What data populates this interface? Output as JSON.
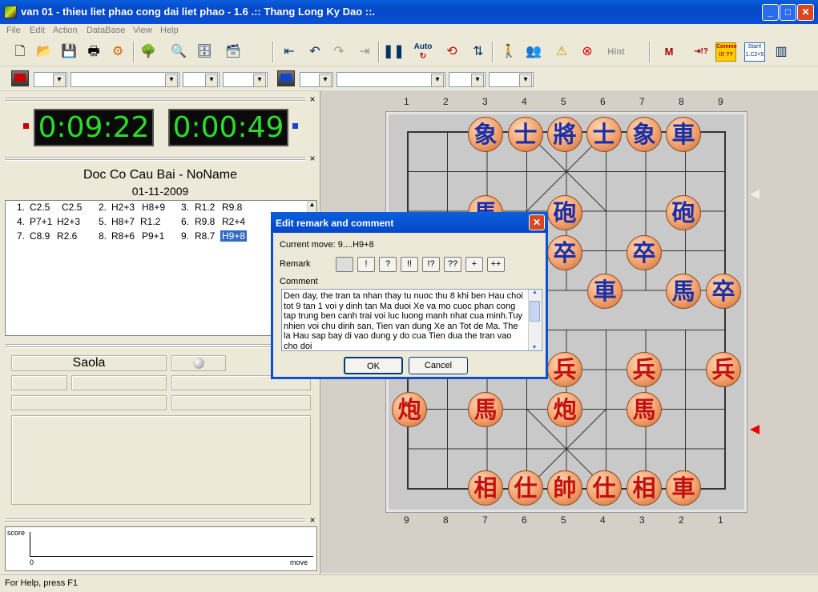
{
  "window": {
    "title": "van 01 - thieu liet phao cong dai liet phao - 1.6 .:: Thang Long Ky Dao ::."
  },
  "menu": [
    "File",
    "Edit",
    "Action",
    "DataBase",
    "View",
    "Help"
  ],
  "toolbar": {
    "auto_label": "Auto",
    "hint_label": "Hint",
    "comme_label": "Comme !!! ??",
    "start_label": "Start! 1.C2=5"
  },
  "clocks": {
    "red": "0:09:22",
    "black": "0:00:49"
  },
  "game": {
    "title": "Doc Co Cau Bai - NoName",
    "date": "01-11-2009"
  },
  "moves": [
    {
      "num": "1.",
      "red": "C2.5",
      "black": "C2.5"
    },
    {
      "num": "2.",
      "red": "H2+3",
      "black": "H8+9"
    },
    {
      "num": "3.",
      "red": "R1.2",
      "black": "R9.8"
    },
    {
      "num": "4.",
      "red": "P7+1",
      "black": "H2+3"
    },
    {
      "num": "5.",
      "red": "H8+7",
      "black": "R1.2"
    },
    {
      "num": "6.",
      "red": "R9.8",
      "black": "R2+4"
    },
    {
      "num": "7.",
      "red": "C8.9",
      "black": "R2.6"
    },
    {
      "num": "8.",
      "red": "R8+6",
      "black": "P9+1"
    },
    {
      "num": "9.",
      "red": "R8.7",
      "black": "H9+8"
    }
  ],
  "engine": {
    "name": "Saola"
  },
  "graph": {
    "ylabel": "score",
    "xlabel": "move",
    "origin": "0"
  },
  "board": {
    "files_top": [
      "1",
      "2",
      "3",
      "4",
      "5",
      "6",
      "7",
      "8",
      "9"
    ],
    "files_bottom": [
      "9",
      "8",
      "7",
      "6",
      "5",
      "4",
      "3",
      "2",
      "1"
    ],
    "pieces": [
      {
        "ch": "象",
        "side": "black"
      },
      {
        "ch": "士",
        "side": "black"
      },
      {
        "ch": "將",
        "side": "black"
      },
      {
        "ch": "士",
        "side": "black"
      },
      {
        "ch": "象",
        "side": "black"
      },
      {
        "ch": "車",
        "side": "black"
      },
      {
        "ch": "馬",
        "side": "black"
      },
      {
        "ch": "砲",
        "side": "black"
      },
      {
        "ch": "砲",
        "side": "black"
      },
      {
        "ch": "卒",
        "side": "black"
      },
      {
        "ch": "卒",
        "side": "black"
      },
      {
        "ch": "車",
        "side": "black"
      },
      {
        "ch": "馬",
        "side": "black"
      },
      {
        "ch": "卒",
        "side": "black"
      },
      {
        "ch": "兵",
        "side": "red"
      },
      {
        "ch": "兵",
        "side": "red"
      },
      {
        "ch": "兵",
        "side": "red"
      },
      {
        "ch": "炮",
        "side": "red"
      },
      {
        "ch": "馬",
        "side": "red"
      },
      {
        "ch": "炮",
        "side": "red"
      },
      {
        "ch": "馬",
        "side": "red"
      },
      {
        "ch": "相",
        "side": "red"
      },
      {
        "ch": "仕",
        "side": "red"
      },
      {
        "ch": "帥",
        "side": "red"
      },
      {
        "ch": "仕",
        "side": "red"
      },
      {
        "ch": "相",
        "side": "red"
      },
      {
        "ch": "車",
        "side": "red"
      }
    ]
  },
  "dialog": {
    "title": "Edit remark and comment",
    "current_move": "Current move: 9....H9+8",
    "remark_label": "Remark",
    "remark_options": [
      "",
      "!",
      "?",
      "!!",
      "!?",
      "??",
      "+",
      "++"
    ],
    "comment_label": "Comment",
    "comment": "Den day, the tran ta nhan thay tu nuoc thu 8 khi ben Hau choi tot 9 tan 1 voi y dinh tan Ma duoi Xe va mo cuoc phan cong tap trung ben canh trai voi luc luong manh nhat cua minh.Tuy nhien voi chu dinh san, Tien van dung Xe an Tot de Ma. The la Hau sap bay di vao dung y do cua Tien dua the tran vao cho doi",
    "ok": "OK",
    "cancel": "Cancel"
  },
  "status": {
    "text": "For Help, press F1"
  }
}
